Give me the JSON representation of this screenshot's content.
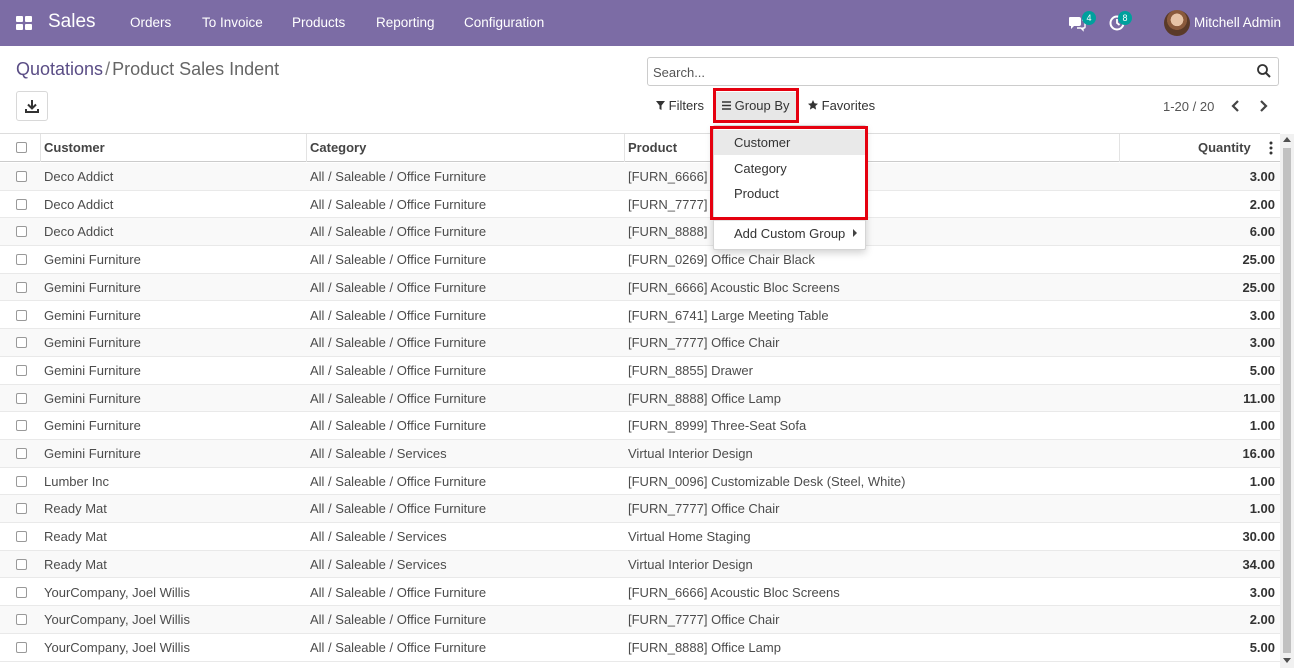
{
  "navbar": {
    "brand": "Sales",
    "menu": [
      "Orders",
      "To Invoice",
      "Products",
      "Reporting",
      "Configuration"
    ],
    "messages_count": "4",
    "activities_count": "8",
    "user_name": "Mitchell Admin",
    "bg_color": "#7c6ca5"
  },
  "breadcrumb": {
    "parent": "Quotations",
    "separator": "/",
    "current": "Product Sales Indent"
  },
  "search": {
    "placeholder": "Search..."
  },
  "filters": {
    "filters_label": "Filters",
    "groupby_label": "Group By",
    "favorites_label": "Favorites"
  },
  "pager": {
    "text": "1-20 / 20"
  },
  "table": {
    "headers": {
      "customer": "Customer",
      "category": "Category",
      "product": "Product",
      "quantity": "Quantity"
    },
    "rows": [
      {
        "customer": "Deco Addict",
        "category": "All / Saleable / Office Furniture",
        "product": "[FURN_6666]",
        "quantity": "3.00"
      },
      {
        "customer": "Deco Addict",
        "category": "All / Saleable / Office Furniture",
        "product": "[FURN_7777]",
        "quantity": "2.00"
      },
      {
        "customer": "Deco Addict",
        "category": "All / Saleable / Office Furniture",
        "product": "[FURN_8888]",
        "quantity": "6.00"
      },
      {
        "customer": "Gemini Furniture",
        "category": "All / Saleable / Office Furniture",
        "product": "[FURN_0269] Office Chair Black",
        "quantity": "25.00"
      },
      {
        "customer": "Gemini Furniture",
        "category": "All / Saleable / Office Furniture",
        "product": "[FURN_6666] Acoustic Bloc Screens",
        "quantity": "25.00"
      },
      {
        "customer": "Gemini Furniture",
        "category": "All / Saleable / Office Furniture",
        "product": "[FURN_6741] Large Meeting Table",
        "quantity": "3.00"
      },
      {
        "customer": "Gemini Furniture",
        "category": "All / Saleable / Office Furniture",
        "product": "[FURN_7777] Office Chair",
        "quantity": "3.00"
      },
      {
        "customer": "Gemini Furniture",
        "category": "All / Saleable / Office Furniture",
        "product": "[FURN_8855] Drawer",
        "quantity": "5.00"
      },
      {
        "customer": "Gemini Furniture",
        "category": "All / Saleable / Office Furniture",
        "product": "[FURN_8888] Office Lamp",
        "quantity": "11.00"
      },
      {
        "customer": "Gemini Furniture",
        "category": "All / Saleable / Office Furniture",
        "product": "[FURN_8999] Three-Seat Sofa",
        "quantity": "1.00"
      },
      {
        "customer": "Gemini Furniture",
        "category": "All / Saleable / Services",
        "product": "Virtual Interior Design",
        "quantity": "16.00"
      },
      {
        "customer": "Lumber Inc",
        "category": "All / Saleable / Office Furniture",
        "product": "[FURN_0096] Customizable Desk (Steel, White)",
        "quantity": "1.00"
      },
      {
        "customer": "Ready Mat",
        "category": "All / Saleable / Office Furniture",
        "product": "[FURN_7777] Office Chair",
        "quantity": "1.00"
      },
      {
        "customer": "Ready Mat",
        "category": "All / Saleable / Services",
        "product": "Virtual Home Staging",
        "quantity": "30.00"
      },
      {
        "customer": "Ready Mat",
        "category": "All / Saleable / Services",
        "product": "Virtual Interior Design",
        "quantity": "34.00"
      },
      {
        "customer": "YourCompany, Joel Willis",
        "category": "All / Saleable / Office Furniture",
        "product": "[FURN_6666] Acoustic Bloc Screens",
        "quantity": "3.00"
      },
      {
        "customer": "YourCompany, Joel Willis",
        "category": "All / Saleable / Office Furniture",
        "product": "[FURN_7777] Office Chair",
        "quantity": "2.00"
      },
      {
        "customer": "YourCompany, Joel Willis",
        "category": "All / Saleable / Office Furniture",
        "product": "[FURN_8888] Office Lamp",
        "quantity": "5.00"
      }
    ]
  },
  "groupby_dropdown": {
    "options": [
      "Customer",
      "Category",
      "Product"
    ],
    "custom_group_label": "Add Custom Group"
  },
  "highlight_color": "#e5000f"
}
